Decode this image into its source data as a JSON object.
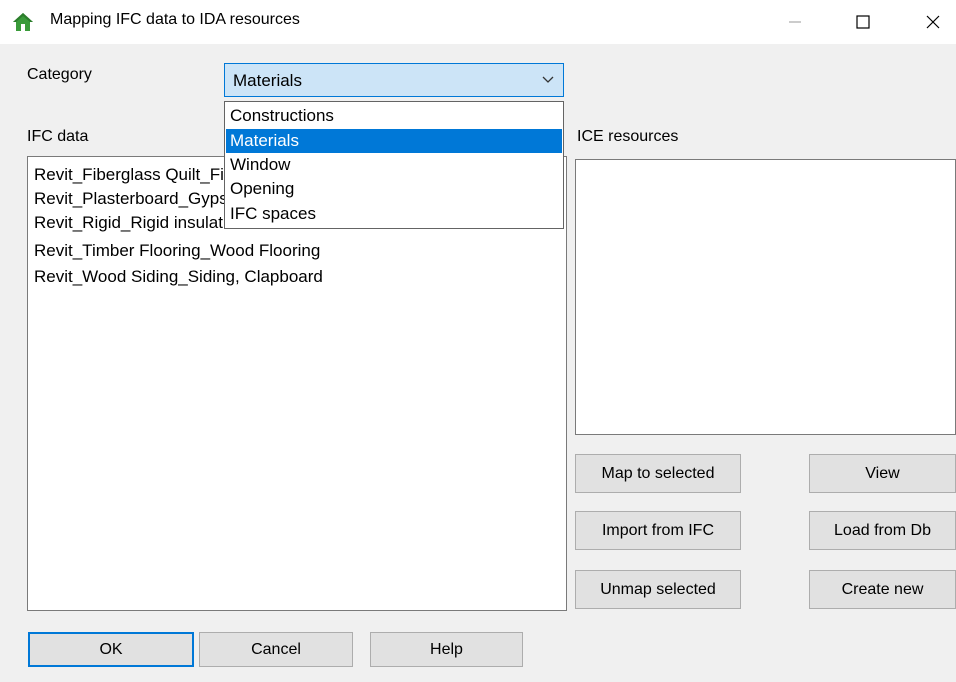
{
  "window": {
    "title": "Mapping IFC data to IDA resources",
    "icon": "house-icon",
    "controls": {
      "minimize": "minimize-icon",
      "maximize": "maximize-icon",
      "close": "close-icon"
    }
  },
  "category": {
    "label": "Category",
    "selected": "Materials",
    "options": [
      "Constructions",
      "Materials",
      "Window",
      "Opening",
      "IFC spaces"
    ],
    "highlighted_index": 1
  },
  "ifc_data": {
    "label": "IFC data",
    "items": [
      "Revit_Fiberglass Quilt_Fiberglass Insulation",
      "Revit_Plasterboard_Gypsum Wall Board",
      "Revit_Rigid_Rigid insulation",
      "Revit_Timber Flooring_Wood Flooring",
      "Revit_Wood Siding_Siding, Clapboard"
    ]
  },
  "ice_resources": {
    "label": "ICE resources",
    "items": []
  },
  "actions": {
    "map_to_selected": "Map to selected",
    "view": "View",
    "import_from_ifc": "Import from IFC",
    "load_from_db": "Load from Db",
    "unmap_selected": "Unmap selected",
    "create_new": "Create new"
  },
  "footer": {
    "ok": "OK",
    "cancel": "Cancel",
    "help": "Help"
  },
  "colors": {
    "accent": "#0078d7",
    "combo_bg": "#cce4f7",
    "dialog_bg": "#f0f0f0",
    "button_bg": "#e1e1e1",
    "icon_green": "#3a9b3a"
  }
}
